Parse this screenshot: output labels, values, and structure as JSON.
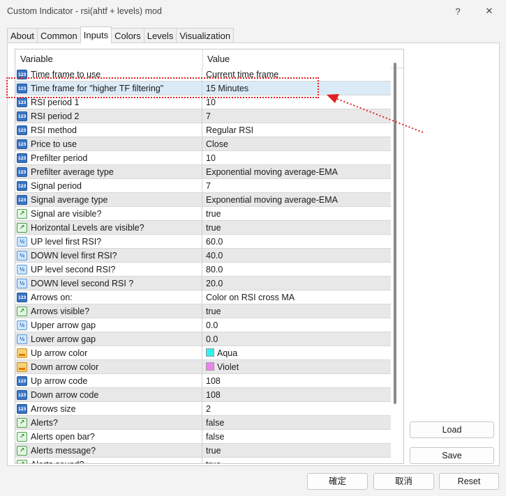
{
  "window": {
    "title": "Custom Indicator - rsi(ahtf + levels) mod",
    "help_icon": "question-icon",
    "close_icon": "close-icon",
    "help_glyph": "?",
    "close_glyph": "✕"
  },
  "tabs": [
    {
      "label": "About"
    },
    {
      "label": "Common"
    },
    {
      "label": "Inputs",
      "active": true
    },
    {
      "label": "Colors"
    },
    {
      "label": "Levels"
    },
    {
      "label": "Visualization"
    }
  ],
  "table": {
    "col_variable": "Variable",
    "col_value": "Value",
    "rows": [
      {
        "type": "int",
        "name": "Time frame to use",
        "value": "Current time frame"
      },
      {
        "type": "int",
        "name": "Time frame for \"higher TF filtering\"",
        "value": "15 Minutes",
        "selected": true
      },
      {
        "type": "int",
        "name": "RSI period 1",
        "value": "10"
      },
      {
        "type": "int",
        "name": "RSI period 2",
        "value": "7"
      },
      {
        "type": "int",
        "name": "RSI method",
        "value": "Regular RSI"
      },
      {
        "type": "int",
        "name": "Price to use",
        "value": "Close"
      },
      {
        "type": "int",
        "name": "Prefilter period",
        "value": "10"
      },
      {
        "type": "int",
        "name": "Prefilter average type",
        "value": "Exponential moving average-EMA"
      },
      {
        "type": "int",
        "name": "Signal period",
        "value": "7"
      },
      {
        "type": "int",
        "name": "Signal average type",
        "value": "Exponential moving average-EMA"
      },
      {
        "type": "bool",
        "name": "Signal are visible?",
        "value": "true"
      },
      {
        "type": "bool",
        "name": "Horizontal Levels are visible?",
        "value": "true"
      },
      {
        "type": "dbl",
        "name": "UP level first RSI?",
        "value": "60.0"
      },
      {
        "type": "dbl",
        "name": "DOWN level first RSI?",
        "value": "40.0"
      },
      {
        "type": "dbl",
        "name": "UP level second RSI?",
        "value": "80.0"
      },
      {
        "type": "dbl",
        "name": "DOWN level second RSI ?",
        "value": "20.0"
      },
      {
        "type": "int",
        "name": "Arrows on:",
        "value": "Color on RSI cross MA"
      },
      {
        "type": "bool",
        "name": "Arrows visible?",
        "value": "true"
      },
      {
        "type": "dbl",
        "name": "Upper arrow gap",
        "value": "0.0"
      },
      {
        "type": "dbl",
        "name": "Lower arrow gap",
        "value": "0.0"
      },
      {
        "type": "clr",
        "name": "Up arrow color",
        "value": "Aqua",
        "swatch": "#33f0f0"
      },
      {
        "type": "clr",
        "name": "Down arrow color",
        "value": "Violet",
        "swatch": "#ee82ee"
      },
      {
        "type": "int",
        "name": "Up arrow code",
        "value": "108"
      },
      {
        "type": "int",
        "name": "Down arrow code",
        "value": "108"
      },
      {
        "type": "int",
        "name": "Arrows size",
        "value": "2"
      },
      {
        "type": "bool",
        "name": "Alerts?",
        "value": "false"
      },
      {
        "type": "bool",
        "name": "Alerts open bar?",
        "value": "false"
      },
      {
        "type": "bool",
        "name": "Alerts message?",
        "value": "true"
      },
      {
        "type": "bool",
        "name": "Alerts sound?",
        "value": "true"
      }
    ]
  },
  "icon_glyphs": {
    "int": "123",
    "dbl": "½",
    "bool": "↗",
    "clr": ""
  },
  "side_buttons": {
    "load": "Load",
    "save": "Save"
  },
  "footer_buttons": {
    "ok": "確定",
    "cancel": "取消",
    "reset": "Reset"
  },
  "annotation": {
    "color": "#e02020"
  }
}
